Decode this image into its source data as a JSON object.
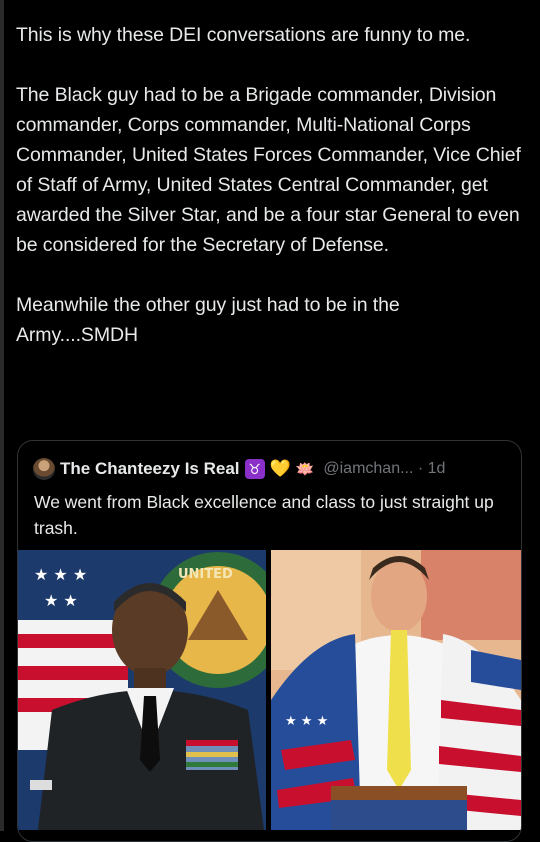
{
  "post": {
    "text": "This is why these DEI conversations are funny to me.\n\nThe Black guy had to be a Brigade commander, Division commander, Corps commander, Multi-National Corps Commander, United States Forces Commander, Vice Chief of Staff of Army, United States Central Commander, get awarded the Silver Star, and be a four star General to even be considered for the Secretary of Defense.\n\nMeanwhile the other guy just had to be in the Army....SMDH"
  },
  "quote": {
    "author_name": "The Chanteezy Is Real",
    "handle_time": "@iamchan... · 1d",
    "text": "We went from Black excellence and class to just straight up trash.",
    "badges": {
      "zodiac": "♉",
      "heart": "💛",
      "lotus": "🪷"
    },
    "images": [
      {
        "icon": "general-portrait",
        "seal_text": "UNITED"
      },
      {
        "icon": "man-flag-jacket-photo"
      }
    ]
  },
  "colors": {
    "background": "#000000",
    "text": "#e7e9ea",
    "muted": "#71767b",
    "border": "#2f3336",
    "badge": "#8b2fc9"
  }
}
